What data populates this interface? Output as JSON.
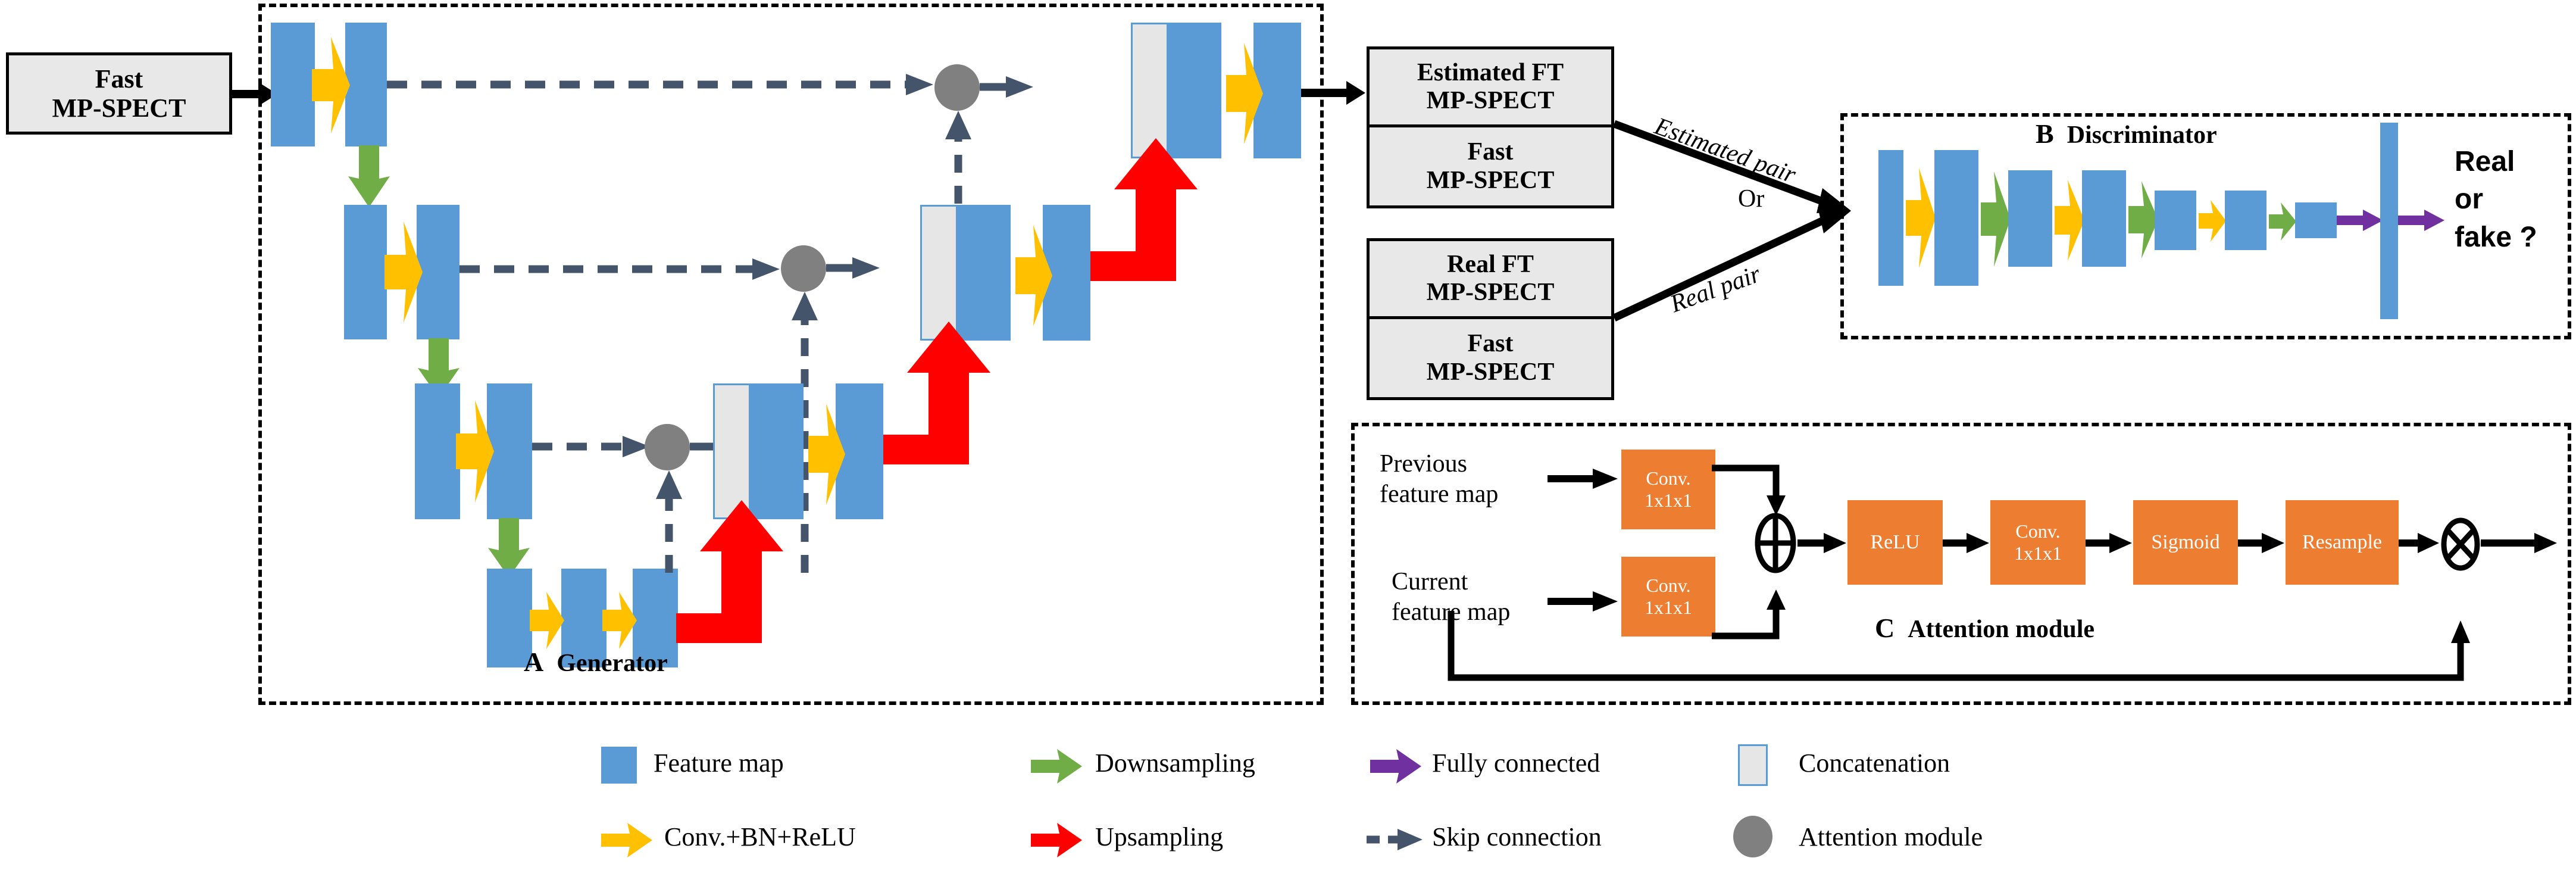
{
  "figure": {
    "type": "architecture-diagram",
    "title": "Attention-GAN for fast MP-SPECT full-time image estimation"
  },
  "colors": {
    "feature_map": "#5b9bd5",
    "conv_bn_relu": "#ffc000",
    "downsampling": "#70ad47",
    "upsampling": "#ff0000",
    "fully_connected": "#7030a0",
    "skip_connection": "#44546a",
    "attention_node": "#808080",
    "concatenation_fill": "#e7e6e6",
    "attention_block": "#ed7d31",
    "io_box_fill": "#e8e8e8"
  },
  "input": {
    "label_line1": "Fast",
    "label_line2": "MP-SPECT"
  },
  "generator": {
    "panel_letter": "A",
    "panel_title": "Generator"
  },
  "pairs": {
    "estimated": {
      "top_line1": "Estimated FT",
      "top_line2": "MP-SPECT",
      "bottom_line1": "Fast",
      "bottom_line2": "MP-SPECT"
    },
    "real": {
      "top_line1": "Real FT",
      "top_line2": "MP-SPECT",
      "bottom_line1": "Fast",
      "bottom_line2": "MP-SPECT"
    },
    "estimated_arrow_label": "Estimated pair",
    "or_label": "Or",
    "real_arrow_label": "Real pair"
  },
  "discriminator": {
    "panel_letter": "B",
    "panel_title": "Discriminator",
    "output_line1": "Real",
    "output_line2": "or",
    "output_line3": "fake ?"
  },
  "attention": {
    "panel_letter": "C",
    "panel_title": "Attention module",
    "input_previous_line1": "Previous",
    "input_previous_line2": "feature map",
    "input_current_line1": "Current",
    "input_current_line2": "feature map",
    "conv_prev_line1": "Conv.",
    "conv_prev_line2": "1x1x1",
    "conv_curr_line1": "Conv.",
    "conv_curr_line2": "1x1x1",
    "relu": "ReLU",
    "conv3_line1": "Conv.",
    "conv3_line2": "1x1x1",
    "sigmoid": "Sigmoid",
    "resample": "Resample",
    "sum_symbol": "⊕",
    "mul_symbol": "⊗"
  },
  "legend": {
    "items": [
      {
        "icon": "feature-map-swatch",
        "label": "Feature map"
      },
      {
        "icon": "downsampling-arrow",
        "label": "Downsampling"
      },
      {
        "icon": "fully-connected-arrow",
        "label": "Fully connected"
      },
      {
        "icon": "concatenation-swatch",
        "label": "Concatenation"
      },
      {
        "icon": "conv-bn-relu-arrow",
        "label": "Conv.+BN+ReLU"
      },
      {
        "icon": "upsampling-arrow",
        "label": "Upsampling"
      },
      {
        "icon": "skip-connection-arrow",
        "label": "Skip connection"
      },
      {
        "icon": "attention-module-dot",
        "label": "Attention module"
      }
    ]
  }
}
